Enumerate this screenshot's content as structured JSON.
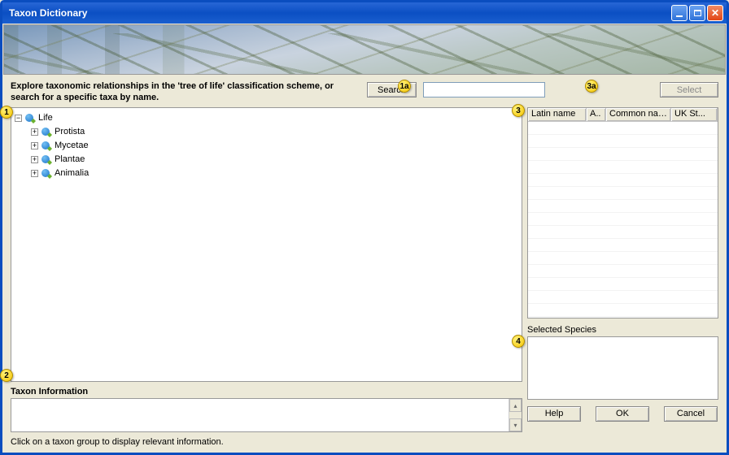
{
  "window": {
    "title": "Taxon Dictionary"
  },
  "instruction": "Explore taxonomic relationships in the 'tree of life' classification scheme, or search for a specific taxa by name.",
  "search": {
    "button_label": "Search",
    "input_value": ""
  },
  "select": {
    "button_label": "Select"
  },
  "tree": {
    "root": "Life",
    "children": [
      "Protista",
      "Mycetae",
      "Plantae",
      "Animalia"
    ]
  },
  "info": {
    "header": "Taxon Information",
    "text": "",
    "hint": "Click on a taxon group to display relevant information."
  },
  "grid": {
    "columns": [
      "Latin name",
      "A..",
      "Common name",
      "UK St..."
    ]
  },
  "selected": {
    "header": "Selected Species"
  },
  "buttons": {
    "help": "Help",
    "ok": "OK",
    "cancel": "Cancel"
  },
  "annotations": {
    "1": "1",
    "1a": "1a",
    "2": "2",
    "3": "3",
    "3a": "3a",
    "4": "4"
  }
}
